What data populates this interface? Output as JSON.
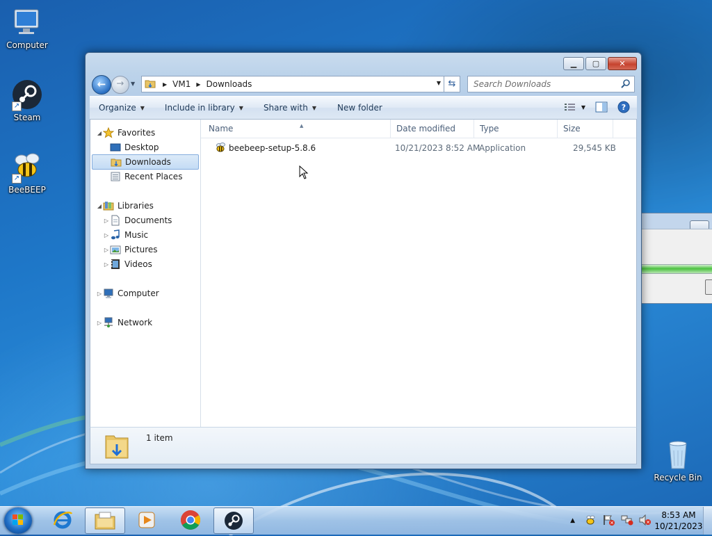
{
  "desktop": {
    "icons": [
      {
        "label": "Computer"
      },
      {
        "label": "Steam"
      },
      {
        "label": "BeeBEEP"
      },
      {
        "label": "Recycle Bin"
      }
    ]
  },
  "explorer": {
    "breadcrumb": [
      "VM1",
      "Downloads"
    ],
    "search_placeholder": "Search Downloads",
    "toolbar": {
      "organize": "Organize",
      "include_in_library": "Include in library",
      "share_with": "Share with",
      "new_folder": "New folder"
    },
    "nav": {
      "favorites": "Favorites",
      "desktop": "Desktop",
      "downloads": "Downloads",
      "recent_places": "Recent Places",
      "libraries": "Libraries",
      "documents": "Documents",
      "music": "Music",
      "pictures": "Pictures",
      "videos": "Videos",
      "computer": "Computer",
      "network": "Network"
    },
    "columns": {
      "name": "Name",
      "date_modified": "Date modified",
      "type": "Type",
      "size": "Size"
    },
    "files": [
      {
        "name": "beebeep-setup-5.8.6",
        "date_modified": "10/21/2023 8:52 AM",
        "type": "Application",
        "size": "29,545 KB"
      }
    ],
    "status": "1 item"
  },
  "taskbar": {
    "clock_time": "8:53 AM",
    "clock_date": "10/21/2023"
  }
}
